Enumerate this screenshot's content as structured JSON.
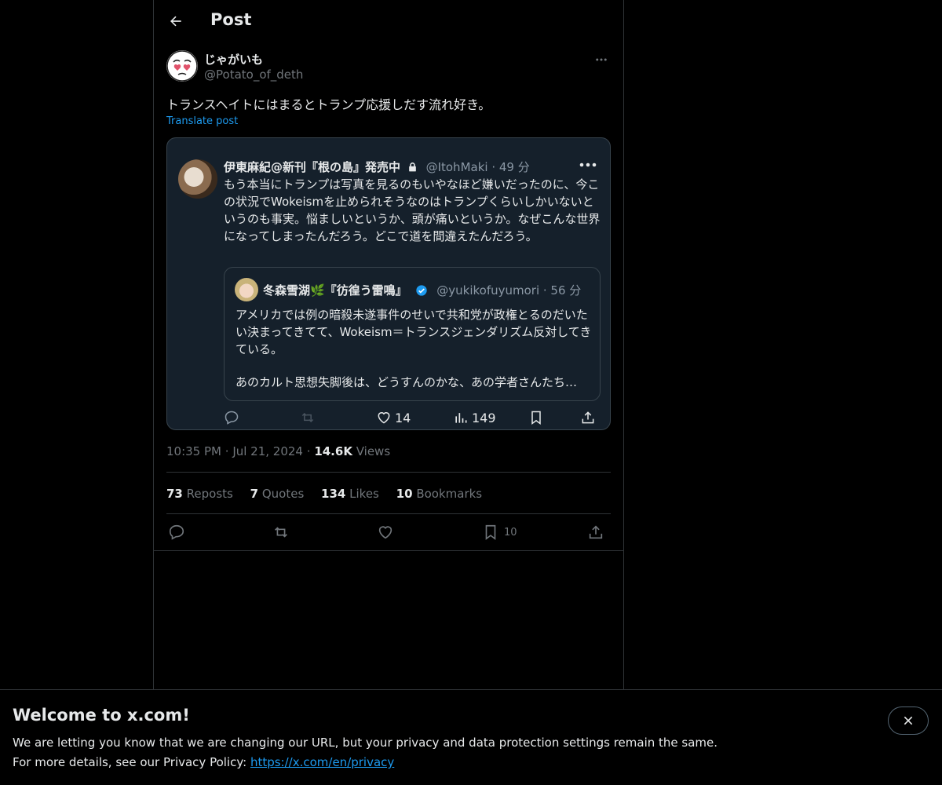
{
  "header": {
    "title": "Post"
  },
  "post": {
    "author_name": "じゃがいも",
    "author_handle": "@Potato_of_deth",
    "text": "トランスヘイトにはまるとトランプ応援しだす流れ好き。",
    "translate_label": "Translate post",
    "time": "10:35 PM",
    "date": "Jul 21, 2024",
    "views_count": "14.6K",
    "views_label": "Views"
  },
  "quoted": {
    "name": "伊東麻紀@新刊『根の島』発売中",
    "handle": "@ItohMaki · 49 分",
    "text": "もう本当にトランプは写真を見るのもいやなほど嫌いだったのに、今この状況でWokeismを止められそうなのはトランプくらいしかいないというのも事実。悩ましいというか、頭が痛いというか。なぜこんな世界になってしまったんだろう。どこで道を間違えたんだろう。",
    "inner": {
      "name": "冬森雪湖🌿『彷徨う雷鳴』",
      "handle": "@yukikofuyumori · 56 分",
      "text": "アメリカでは例の暗殺未遂事件のせいで共和党が政権とるのだいたい決まってきてて、Wokeism＝トランスジェンダリズム反対してきている。",
      "text2": "あのカルト思想失脚後は、どうすんのかな、あの学者さんたち…"
    },
    "likes": "14",
    "views": "149"
  },
  "stats": {
    "reposts_count": "73",
    "reposts_label": "Reposts",
    "quotes_count": "7",
    "quotes_label": "Quotes",
    "likes_count": "134",
    "likes_label": "Likes",
    "bookmarks_count": "10",
    "bookmarks_label": "Bookmarks"
  },
  "actions": {
    "bookmark_count": "10"
  },
  "banner": {
    "title": "Welcome to x.com!",
    "line1": "We are letting you know that we are changing our URL, but your privacy and data protection settings remain the same.",
    "line2_prefix": "For more details, see our Privacy Policy: ",
    "link": "https://x.com/en/privacy"
  },
  "colors": {
    "accent": "#1d9bf0",
    "background": "#000000",
    "muted": "#71767b",
    "border": "#2f3336"
  },
  "icons": [
    "back-arrow-icon",
    "more-icon",
    "lock-icon",
    "verified-icon",
    "reply-icon",
    "repost-icon",
    "like-icon",
    "views-icon",
    "bookmark-icon",
    "share-icon",
    "close-icon"
  ]
}
